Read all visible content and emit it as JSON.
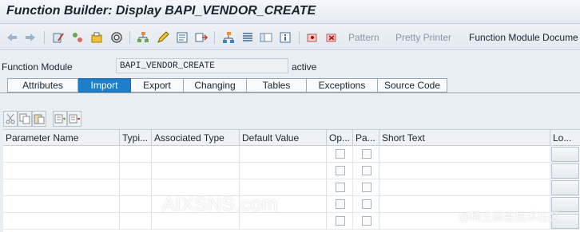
{
  "window": {
    "title": "Function Builder: Display BAPI_VENDOR_CREATE"
  },
  "toolbar": {
    "icons": [
      "back-arrow-icon",
      "forward-arrow-icon",
      "display-change-icon",
      "active-inactive-icon",
      "other-object-icon",
      "where-used-icon",
      "hierarchy-icon",
      "edit-icon",
      "display-object-list-icon",
      "navigate-icon",
      "object-tree-icon",
      "stack-icon",
      "frame-icon",
      "info-icon",
      "set-breakpoint-icon",
      "delete-breakpoint-icon"
    ],
    "pattern_label": "Pattern",
    "pretty_printer_label": "Pretty Printer",
    "function_module_doc_label": "Function Module Docume"
  },
  "function_module": {
    "label": "Function Module",
    "value": "BAPI_VENDOR_CREATE",
    "status": "active"
  },
  "tabs": [
    {
      "label": "Attributes",
      "active": false
    },
    {
      "label": "Import",
      "active": true
    },
    {
      "label": "Export",
      "active": false
    },
    {
      "label": "Changing",
      "active": false
    },
    {
      "label": "Tables",
      "active": false
    },
    {
      "label": "Exceptions",
      "active": false
    },
    {
      "label": "Source Code",
      "active": false
    }
  ],
  "row_toolbar": {
    "icons": [
      "cut-icon",
      "copy-icon",
      "paste-icon",
      "insert-row-icon",
      "delete-row-icon"
    ]
  },
  "grid": {
    "columns": [
      "Parameter Name",
      "Typi...",
      "Associated Type",
      "Default Value",
      "Op...",
      "Pa...",
      "Short Text",
      "Lo..."
    ],
    "row_count": 5
  },
  "watermark": {
    "main": "AIXSNS.com",
    "secondary": "@稀土掘金技术社区"
  },
  "colors": {
    "active_tab": "#1d7fc9",
    "background": "#e9eef3"
  }
}
